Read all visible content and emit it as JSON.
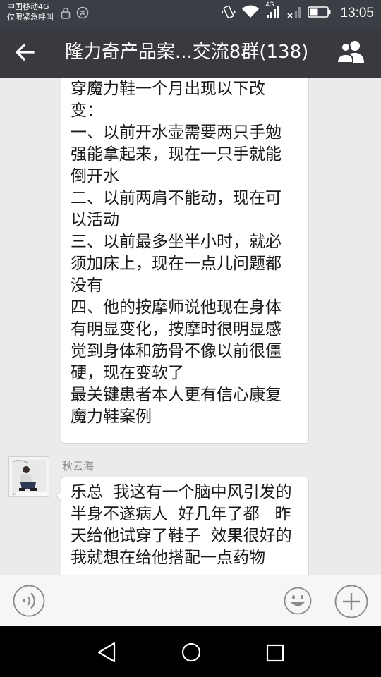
{
  "status_bar": {
    "carrier_line1": "中国移动4G",
    "carrier_line2": "仅限紧急呼叫",
    "network_label": "4G",
    "time": "13:05",
    "icons": [
      "lock-icon",
      "no-sim-icon",
      "vibrate-icon",
      "wifi-icon",
      "signal-icon",
      "signal-x-icon",
      "battery-icon"
    ]
  },
  "header": {
    "title": "隆力奇产品案...交流8群(138)",
    "back_icon": "back-arrow-icon",
    "members_icon": "group-members-icon"
  },
  "messages": [
    {
      "lines": [
        "穿魔力鞋一个月出现以下改",
        "变：",
        "一、以前开水壶需要两只手勉",
        "强能拿起来，现在一只手就能",
        "倒开水",
        "二、以前两肩不能动，现在可",
        "以活动",
        "三、以前最多坐半小时，就必",
        "须加床上，现在一点儿问题都",
        "没有",
        "四、他的按摩师说他现在身体",
        "有明显变化，按摩时很明显感",
        "觉到身体和筋骨不像以前很僵",
        "硬，现在变软了",
        "最关键患者本人更有信心康复",
        "魔力鞋案例"
      ]
    },
    {
      "sender": "秋云海",
      "lines": [
        "乐总  我这有一个脑中风引发的",
        "半身不遂病人  好几年了都   昨",
        "天给他试穿了鞋子  效果很好的",
        "我就想在给他搭配一点药物"
      ]
    }
  ],
  "input_bar": {
    "placeholder": "",
    "value": "",
    "icons": [
      "voice-icon",
      "emoji-icon",
      "plus-icon"
    ]
  },
  "nav_bar": {
    "icons": [
      "nav-back-icon",
      "nav-home-icon",
      "nav-recents-icon"
    ]
  },
  "colors": {
    "status_bar_bg": "#3a3e45",
    "title_bar_bg": "#393a3f",
    "chat_bg": "#ebebeb",
    "bubble_bg": "#ffffff",
    "input_bar_bg": "#f6f6f6",
    "nav_bar_bg": "#000000"
  }
}
